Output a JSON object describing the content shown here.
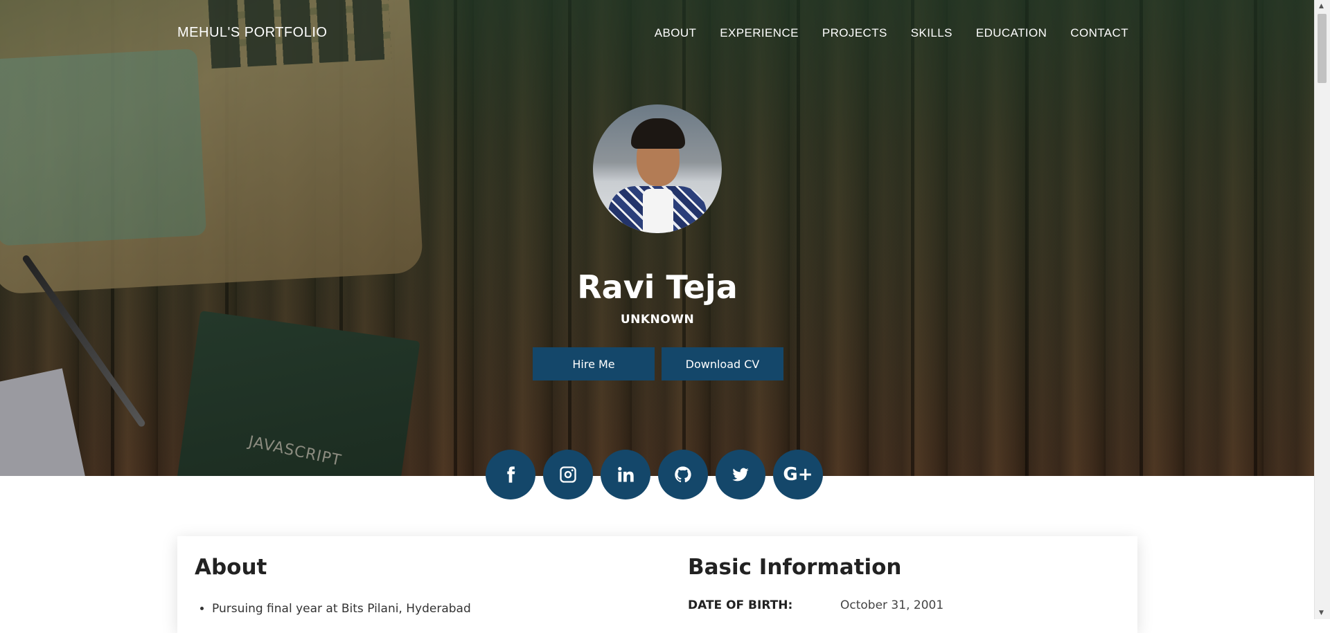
{
  "nav": {
    "brand": "MEHUL'S PORTFOLIO",
    "items": [
      "ABOUT",
      "EXPERIENCE",
      "PROJECTS",
      "SKILLS",
      "EDUCATION",
      "CONTACT"
    ]
  },
  "hero": {
    "name": "Ravi Teja",
    "role": "UNKNOWN",
    "hire_label": "Hire Me",
    "cv_label": "Download CV",
    "book_text": "JAVASCRIPT"
  },
  "social": {
    "icons": [
      "facebook-icon",
      "instagram-icon",
      "linkedin-icon",
      "github-icon",
      "twitter-icon",
      "google-plus-icon"
    ],
    "gplus_text": "G+"
  },
  "about": {
    "title": "About",
    "items": [
      "Pursuing final year at Bits Pilani, Hyderabad"
    ]
  },
  "basic_info": {
    "title": "Basic Information",
    "rows": [
      {
        "key": "DATE OF BIRTH:",
        "value": "October 31, 2001"
      }
    ]
  },
  "colors": {
    "accent": "#14476a",
    "text_dark": "#222222"
  }
}
